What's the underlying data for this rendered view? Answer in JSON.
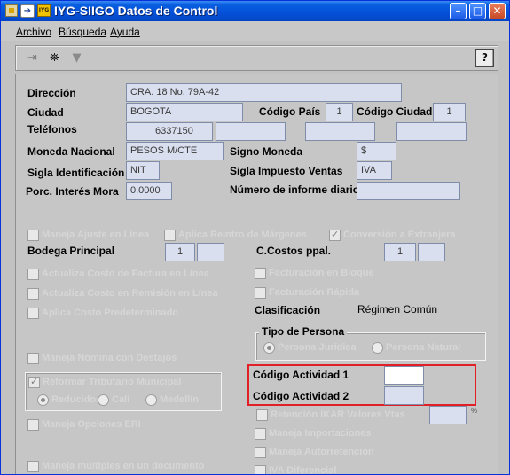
{
  "window": {
    "title": "IYG-SIIGO Datos de Control",
    "brand_badge": "IYG",
    "pin_glyph": "➔",
    "min_glyph": "–",
    "max_glyph": "□",
    "close_glyph": "✕",
    "colors": {
      "titlebar": "#0450d8",
      "highlight_border": "#e21f26",
      "field_bg": "#d9dfee",
      "panel_bg": "#c6c6c6"
    }
  },
  "menu": {
    "archivo": "Archivo",
    "busqueda": "Búsqueda",
    "ayuda": "Ayuda"
  },
  "toolbar": {
    "exit_icon": "exit-door-icon",
    "find_icon": "binoculars-icon",
    "filter_icon": "funnel-icon",
    "help_icon": "help-question-icon",
    "exit_glyph": "⇥",
    "find_glyph": "⛯",
    "filter_glyph": "▼",
    "help_glyph": "?"
  },
  "form": {
    "direccion": {
      "label": "Dirección",
      "value": "CRA. 18 No. 79A-42"
    },
    "ciudad": {
      "label": "Ciudad",
      "value": "BOGOTA"
    },
    "codigo_pais": {
      "label": "Código País",
      "value": "1"
    },
    "codigo_ciudad": {
      "label": "Código Ciudad",
      "value": "1"
    },
    "telefonos": {
      "label": "Teléfonos",
      "values": [
        "6337150",
        "",
        "",
        ""
      ]
    },
    "moneda_nacional": {
      "label": "Moneda Nacional",
      "value": "PESOS M/CTE"
    },
    "signo_moneda": {
      "label": "Signo Moneda",
      "value": "$"
    },
    "sigla_identificacion": {
      "label": "Sigla Identificación",
      "value": "NIT"
    },
    "sigla_impuesto": {
      "label": "Sigla Impuesto Ventas",
      "value": "IVA"
    },
    "porc_interes_mora": {
      "label": "Porc. Interés Mora",
      "value": "0.0000"
    },
    "numero_informe": {
      "label": "Número de informe diario",
      "value": ""
    },
    "bodega_principal": {
      "label": "Bodega Principal",
      "values": [
        "1",
        ""
      ]
    },
    "ccostos_ppal": {
      "label": "C.Costos ppal.",
      "values": [
        "1",
        ""
      ]
    },
    "clasificacion": {
      "label": "Clasificación",
      "value": "Régimen Común"
    },
    "tipo_persona": {
      "title": "Tipo de Persona",
      "selected": "Persona Jurídica",
      "options": [
        "Persona Jurídica",
        "Persona Natural"
      ]
    },
    "codigo_actividad_1": {
      "label": "Código Actividad 1",
      "value": ""
    },
    "codigo_actividad_2": {
      "label": "Código Actividad 2",
      "value": ""
    },
    "ghost_options": {
      "col1": [
        "Maneja Ajuste en Línea",
        "Actualiza Costo de Factura en Línea",
        "Actualiza Costo en Remisión en Línea",
        "Aplica Costo Predeterminado",
        "Maneja Nómina con Destajos",
        "Reformar Tributario Municipal",
        "Maneja Opciones ERI",
        "Maneja múltiples en un documento"
      ],
      "col2": [
        "Aplica Reintro de Márgenes",
        "Conversión a Extranjera",
        "Facturación en Bloque",
        "Facturación Rápida",
        "Retención IKAR Valores Vtas",
        "Maneja Importaciones",
        "Maneja Autorretención",
        "IVA Diferencial"
      ],
      "municipio_radios": [
        "Reducido",
        "Cali",
        "Medellín"
      ]
    },
    "pct_suffix": "%"
  }
}
